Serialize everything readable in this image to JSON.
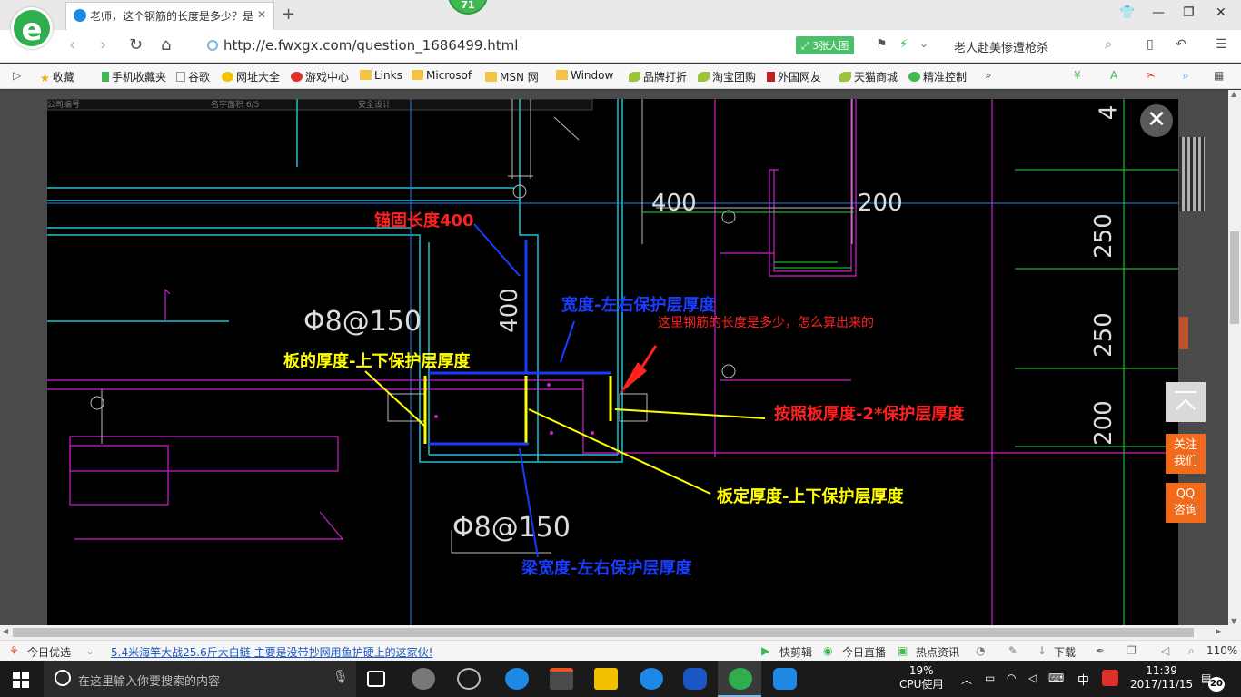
{
  "browser": {
    "logo_letter": "e",
    "tab_title": "老师，这个钢筋的长度是多少？是",
    "tab_close": "✕",
    "new_tab": "+",
    "badge": "71",
    "url": "http://e.fwxgx.com/question_1686499.html",
    "big_image_button": "3张大图",
    "search_text": "老人赴美惨遭枪杀"
  },
  "bookmarks": [
    {
      "label": "收藏",
      "icon": "star-icon"
    },
    {
      "label": "手机收藏夹",
      "icon": "phone-icon"
    },
    {
      "label": "谷歌",
      "icon": "page-icon"
    },
    {
      "label": "网址大全",
      "icon": "globe-icon"
    },
    {
      "label": "游戏中心",
      "icon": "game-icon"
    },
    {
      "label": "Links",
      "icon": "folder-icon"
    },
    {
      "label": "Microsof",
      "icon": "folder-icon"
    },
    {
      "label": "MSN 网",
      "icon": "folder-icon"
    },
    {
      "label": "Window",
      "icon": "folder-icon"
    },
    {
      "label": "品牌打折",
      "icon": "leaf-icon"
    },
    {
      "label": "淘宝团购",
      "icon": "leaf-icon"
    },
    {
      "label": "外国网友",
      "icon": "bookmark-icon"
    },
    {
      "label": "天猫商城",
      "icon": "leaf-icon"
    },
    {
      "label": "精准控制",
      "icon": "chat-icon"
    }
  ],
  "cad": {
    "anchor_length": "锚固长度400",
    "rebar_top": "Φ8@150",
    "rebar_bottom": "Φ8@150",
    "dim_400_top": "400",
    "dim_200_top": "200",
    "dim_400_vert": "400",
    "dim_4": "4",
    "dim_250_a": "250",
    "dim_250_b": "250",
    "dim_200_right": "200",
    "width_label": "宽度-左右保护层厚度",
    "question": "这里钢筋的长度是多少，怎么算出来的",
    "slab_thickness": "板的厚度-上下保护层厚度",
    "by_slab": "按照板厚度-2*保护层厚度",
    "slab_fixed": "板定厚度-上下保护层厚度",
    "beam_width": "梁宽度-左右保护层厚度",
    "header_cells": [
      "公司编号",
      "名字面积 6/5",
      "安全设计"
    ]
  },
  "side": {
    "close": "✕",
    "follow_1": "关注",
    "follow_2": "我们",
    "qq_1": "QQ",
    "qq_2": "咨询"
  },
  "statusbar": {
    "today_pick": "今日优选",
    "news": "5.4米海竿大战25.6斤大白鲢 主要是没带抄网用鱼护硬上的这家伙!",
    "quick_cut": "快剪辑",
    "live": "今日直播",
    "hot_news": "热点资讯",
    "download": "下载",
    "zoom": "110%"
  },
  "taskbar": {
    "search_placeholder": "在这里输入你要搜索的内容",
    "cpu_percent": "19%",
    "cpu_label": "CPU使用",
    "ime": "中",
    "time": "11:39",
    "date": "2017/11/15",
    "notifications": "20"
  },
  "colors": {
    "accent_green": "#2fae4d",
    "cad_bg": "#000000",
    "annotation_red": "#ff2020",
    "annotation_yellow": "#ffff00",
    "annotation_blue": "#1a3cff",
    "side_orange": "#f26a1b"
  }
}
